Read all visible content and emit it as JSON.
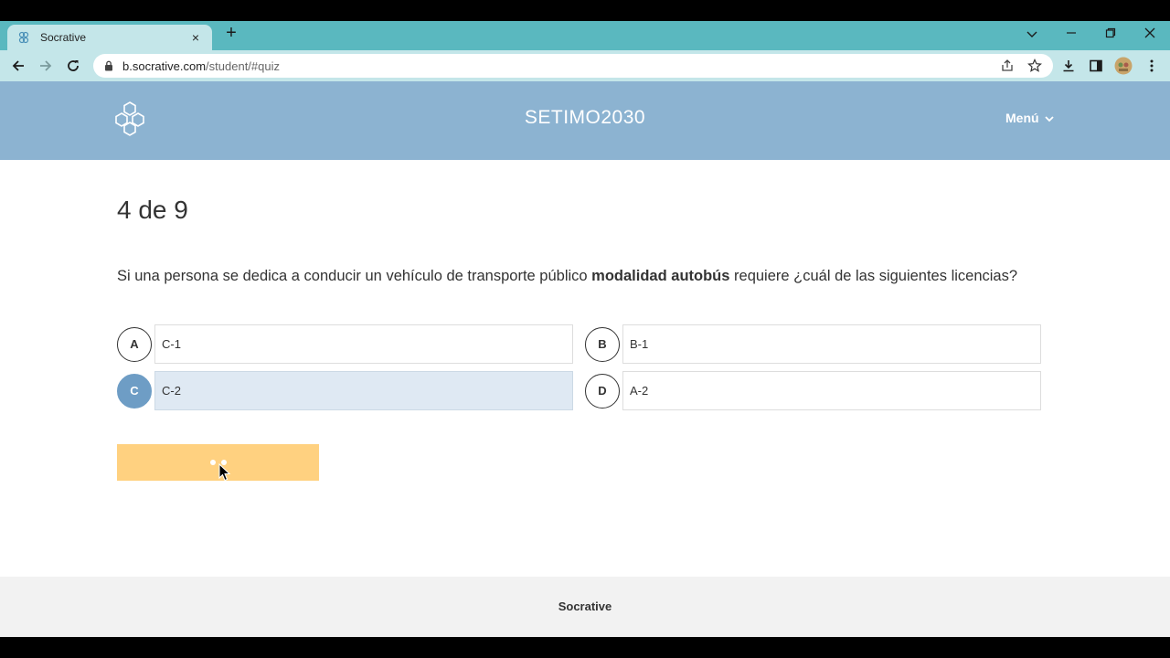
{
  "browser": {
    "tab_title": "Socrative",
    "tab_close": "×",
    "new_tab": "+",
    "url_host": "b.socrative.com",
    "url_path": "/student/#quiz"
  },
  "app": {
    "title": "SETIMO2030",
    "menu_label": "Menú"
  },
  "quiz": {
    "progress": "4 de 9",
    "question_prefix": "Si una persona se dedica a conducir un vehículo de transporte público ",
    "question_bold": "modalidad autobús",
    "question_suffix": " requiere ¿cuál de las siguientes licencias?",
    "choices": [
      {
        "letter": "A",
        "text": "C-1"
      },
      {
        "letter": "B",
        "text": "B-1"
      },
      {
        "letter": "C",
        "text": "C-2"
      },
      {
        "letter": "D",
        "text": "A-2"
      }
    ],
    "selected": "C"
  },
  "footer": {
    "brand": "Socrative"
  },
  "colors": {
    "header_bg": "#8cb3d1",
    "selected_circle": "#6e9dc5",
    "submit_bg": "#ffd180",
    "chrome_tabbar": "#5ab8bf"
  }
}
